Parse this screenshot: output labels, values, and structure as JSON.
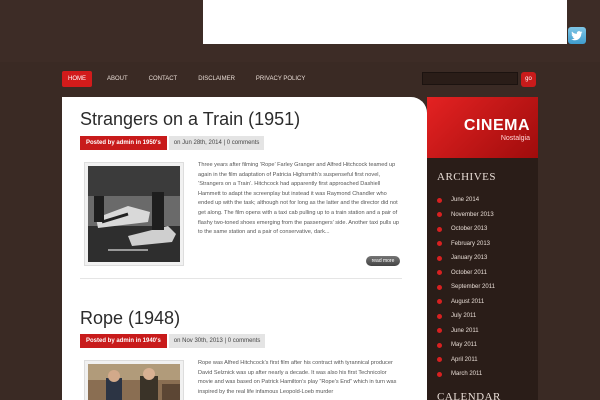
{
  "nav": {
    "items": [
      {
        "label": "HOME",
        "active": true
      },
      {
        "label": "ABOUT",
        "active": false
      },
      {
        "label": "CONTACT",
        "active": false
      },
      {
        "label": "DISCLAIMER",
        "active": false
      },
      {
        "label": "PRIVACY POLICY",
        "active": false
      }
    ]
  },
  "search": {
    "button_label": "go",
    "placeholder": ""
  },
  "social": {
    "icon": "twitter-icon"
  },
  "posts": [
    {
      "title": "Strangers on a Train (1951)",
      "category_label": "Posted by admin in 1950's",
      "date_label": "on Jun 28th, 2014 | 0 comments",
      "excerpt": "Three years after filming ‘Rope’ Farley Granger and Alfred Hitchcock teamed up again in the film adaptation of Patricia Highsmith’s suspenseful first novel, ‘Strangers on a Train’. Hitchcock had apparently first approached Dashiell Hammett to adapt the screenplay but instead it was Raymond Chandler who ended up with the task; although not for long as the latter and the director did not get along. The film opens with a taxi cab pulling up to a train station and a pair of flashy two-toned shoes emerging from the passengers’ side. Another taxi pulls up to the same station and a pair of conservative, dark...",
      "read_more": "read more"
    },
    {
      "title": "Rope (1948)",
      "category_label": "Posted by admin in 1940's",
      "date_label": "on Nov 30th, 2013 | 0 comments",
      "excerpt": "Rope was Alfred Hitchcock’s first film after his contract with tyrannical producer David Selznick was up after nearly a decade. It was also his first Technicolor movie and was based on Patrick Hamilton’s play “Rope’s End” which in turn was inspired by the real life infamous Leopold-Loeb murder"
    }
  ],
  "sidebar": {
    "logo_title": "CINEMA",
    "logo_subtitle": "Nostalgia",
    "archives_title": "ARCHIVES",
    "archives": [
      "June 2014",
      "November 2013",
      "October 2013",
      "February 2013",
      "January 2013",
      "October 2011",
      "September 2011",
      "August 2011",
      "July 2011",
      "June 2011",
      "May 2011",
      "April 2011",
      "March 2011"
    ],
    "calendar_title": "CALENDAR"
  },
  "colors": {
    "accent": "#c81b1b",
    "background": "#3a2a24",
    "sidebar": "#2a1d18"
  }
}
